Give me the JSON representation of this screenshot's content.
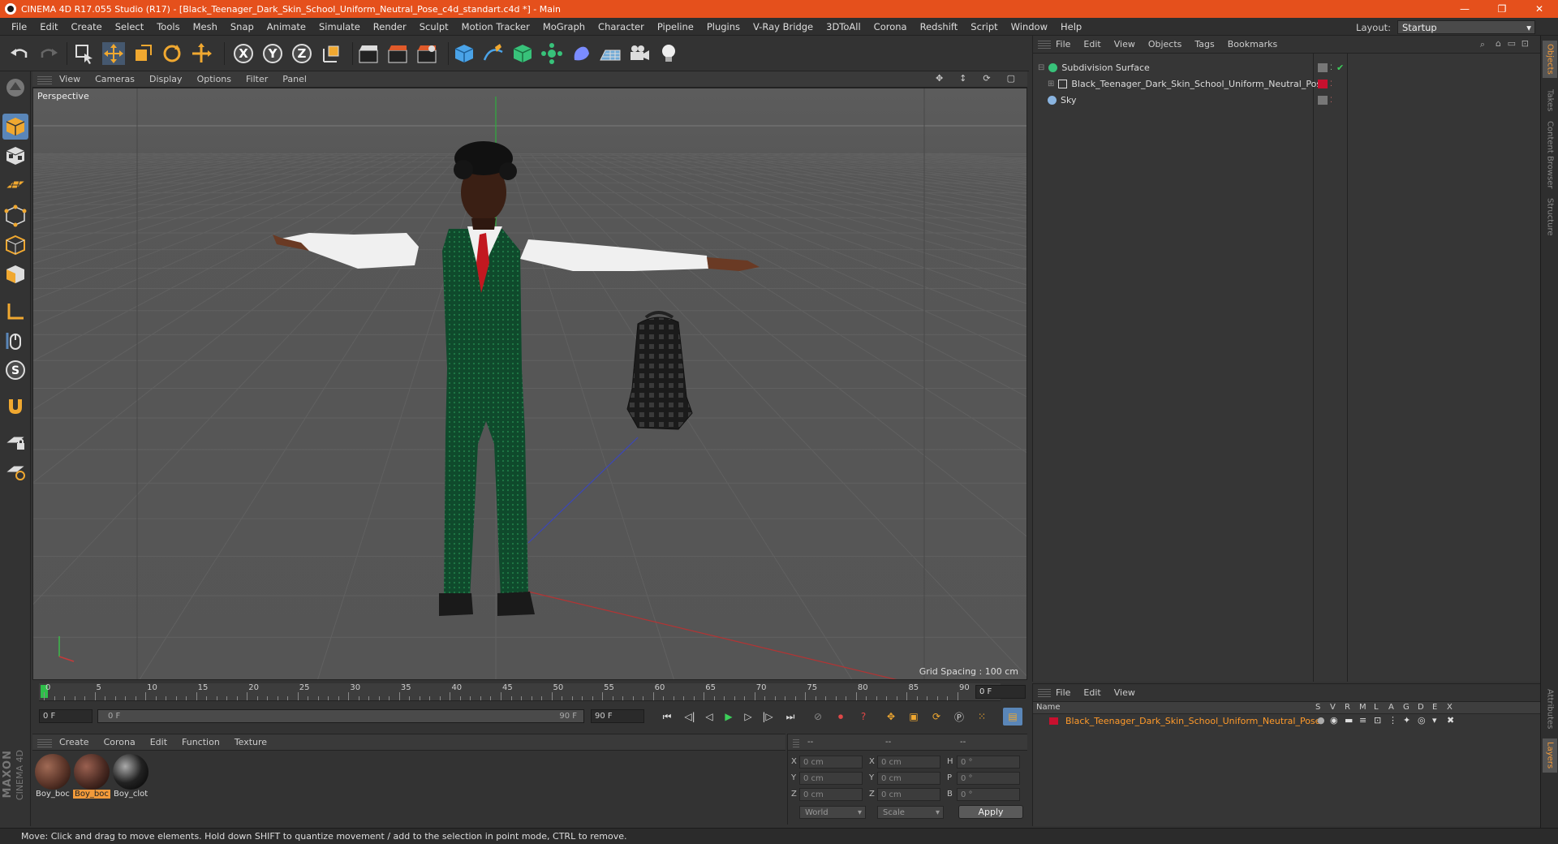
{
  "window": {
    "title": "CINEMA 4D R17.055 Studio (R17) - [Black_Teenager_Dark_Skin_School_Uniform_Neutral_Pose_c4d_standart.c4d *] - Main",
    "minimize": "—",
    "restore": "❐",
    "close": "✕"
  },
  "menu": [
    "File",
    "Edit",
    "Create",
    "Select",
    "Tools",
    "Mesh",
    "Snap",
    "Animate",
    "Simulate",
    "Render",
    "Sculpt",
    "Motion Tracker",
    "MoGraph",
    "Character",
    "Pipeline",
    "Plugins",
    "V-Ray Bridge",
    "3DToAll",
    "Corona",
    "Redshift",
    "Script",
    "Window",
    "Help"
  ],
  "layout": {
    "label": "Layout:",
    "value": "Startup"
  },
  "toolbar": {
    "undo": "undo-icon",
    "axis_x": "X",
    "axis_y": "Y",
    "axis_z": "Z"
  },
  "viewport": {
    "menu": [
      "View",
      "Cameras",
      "Display",
      "Options",
      "Filter",
      "Panel"
    ],
    "label": "Perspective",
    "grid_spacing": "Grid Spacing : 100 cm"
  },
  "timeline": {
    "ticks": [
      "0",
      "5",
      "10",
      "15",
      "20",
      "25",
      "30",
      "35",
      "40",
      "45",
      "50",
      "55",
      "60",
      "65",
      "70",
      "75",
      "80",
      "85",
      "90"
    ],
    "current_frame": "0 F",
    "start": "0 F",
    "range_start": "0 F",
    "range_end": "90 F",
    "end": "90 F"
  },
  "materials": {
    "menu": [
      "Create",
      "Corona",
      "Edit",
      "Function",
      "Texture"
    ],
    "items": [
      {
        "label": "Boy_boc",
        "selected": false,
        "color": "#5a3428"
      },
      {
        "label": "Boy_boc",
        "selected": true,
        "color": "#4a2a22"
      },
      {
        "label": "Boy_clot",
        "selected": false,
        "color": "#222222"
      }
    ]
  },
  "coordinates": {
    "headers": [
      "--",
      "--",
      "--"
    ],
    "rows": [
      {
        "a": "X",
        "av": "0 cm",
        "b": "X",
        "bv": "0 cm",
        "c": "H",
        "cv": "0 °"
      },
      {
        "a": "Y",
        "av": "0 cm",
        "b": "Y",
        "bv": "0 cm",
        "c": "P",
        "cv": "0 °"
      },
      {
        "a": "Z",
        "av": "0 cm",
        "b": "Z",
        "bv": "0 cm",
        "c": "B",
        "cv": "0 °"
      }
    ],
    "mode": "World",
    "size_mode": "Scale",
    "apply": "Apply"
  },
  "objects": {
    "menu": [
      "File",
      "Edit",
      "View",
      "Objects",
      "Tags",
      "Bookmarks"
    ],
    "items": [
      {
        "name": "Subdivision Surface",
        "indent": 0
      },
      {
        "name": "Black_Teenager_Dark_Skin_School_Uniform_Neutral_Pose",
        "indent": 1
      },
      {
        "name": "Sky",
        "indent": 0
      }
    ]
  },
  "layers": {
    "menu": [
      "File",
      "Edit",
      "View"
    ],
    "name_header": "Name",
    "columns": [
      "S",
      "V",
      "R",
      "M",
      "L",
      "A",
      "G",
      "D",
      "E",
      "X"
    ],
    "row": "Black_Teenager_Dark_Skin_School_Uniform_Neutral_Pose"
  },
  "side_tabs": [
    "Objects",
    "Takes",
    "Content Browser",
    "Structure"
  ],
  "side_tabs_bottom": [
    "Attributes",
    "Layers"
  ],
  "status": "Move: Click and drag to move elements. Hold down SHIFT to quantize movement / add to the selection in point mode, CTRL to remove.",
  "brand": {
    "maxon": "MAXON",
    "product": "CINEMA 4D"
  },
  "colors": {
    "title_bar": "#e5501c",
    "accent": "#f29a3a",
    "layer_red": "#c8102e"
  }
}
